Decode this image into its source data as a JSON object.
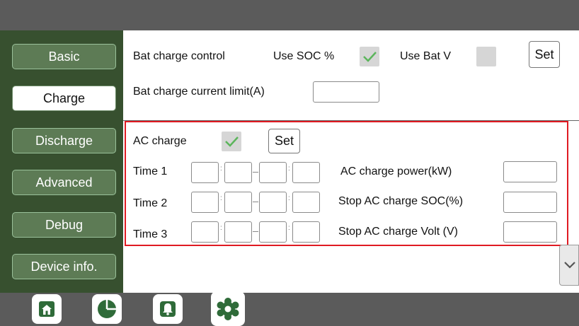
{
  "sidebar": {
    "items": [
      {
        "label": "Basic"
      },
      {
        "label": "Charge"
      },
      {
        "label": "Discharge"
      },
      {
        "label": "Advanced"
      },
      {
        "label": "Debug"
      },
      {
        "label": "Device info."
      }
    ],
    "active": "Charge"
  },
  "bat_charge": {
    "control_label": "Bat charge control",
    "use_soc_label": "Use SOC %",
    "use_soc_checked": true,
    "use_bat_v_label": "Use Bat V",
    "use_bat_v_checked": false,
    "set_label": "Set",
    "current_limit_label": "Bat charge current limit(A)",
    "current_limit_value": ""
  },
  "ac_charge": {
    "label": "AC charge",
    "checked": true,
    "set_label": "Set",
    "times": [
      {
        "label": "Time  1",
        "values": [
          "",
          "",
          "",
          ""
        ]
      },
      {
        "label": "Time  2",
        "values": [
          "",
          "",
          "",
          ""
        ]
      },
      {
        "label": "Time  3",
        "values": [
          "",
          "",
          "",
          ""
        ]
      }
    ],
    "separator": ":",
    "power_label": "AC charge power(kW)",
    "power_value": "",
    "stop_soc_label": "Stop AC charge SOC(%)",
    "stop_soc_value": "",
    "stop_volt_label": "Stop AC charge Volt (V)",
    "stop_volt_value": ""
  },
  "bottom_tabs": [
    {
      "icon": "home-icon"
    },
    {
      "icon": "pie-chart-icon"
    },
    {
      "icon": "bell-icon"
    },
    {
      "icon": "gear-icon",
      "active": true
    }
  ],
  "colors": {
    "accent": "#5bb55b",
    "sidebar_bg": "#37502f",
    "nav_button": "#5d7b55",
    "highlight_frame": "#e01a22",
    "icon_green": "#2f6b39"
  }
}
